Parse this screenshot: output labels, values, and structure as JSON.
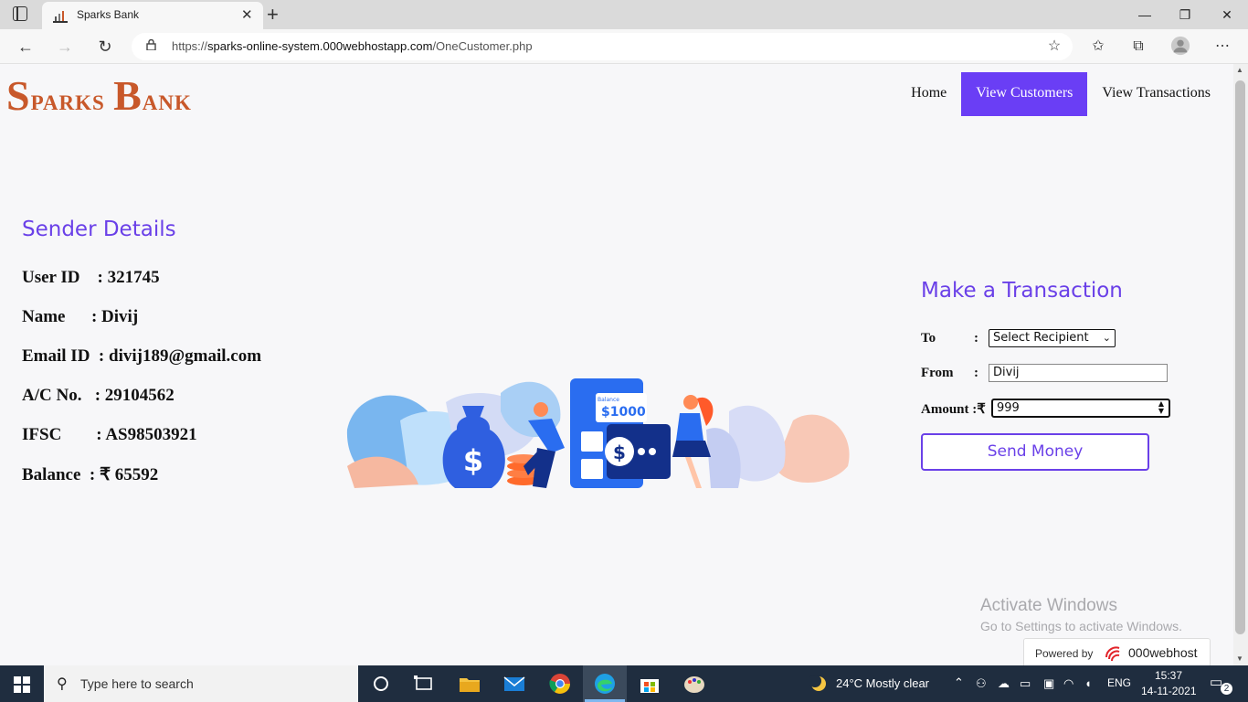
{
  "browser": {
    "tab_title": "Sparks Bank",
    "tab_close": "✕",
    "new_tab": "+",
    "url_prefix": "https://",
    "url_domain": "sparks-online-system.000webhostapp.com",
    "url_path": "/OneCustomer.php",
    "window_buttons": {
      "minimize": "—",
      "restore": "❐",
      "close": "✕"
    }
  },
  "header": {
    "logo": "Sparks Bank",
    "nav": [
      {
        "label": "Home"
      },
      {
        "label": "View Customers",
        "active": true
      },
      {
        "label": "View Transactions"
      }
    ]
  },
  "sender": {
    "heading": "Sender Details",
    "user_id": "User ID    : 321745",
    "name": "Name      : Divij",
    "email": "Email ID  : divij189@gmail.com",
    "account": "A/C No.   : 29104562",
    "ifsc": "IFSC        : AS98503921",
    "balance": "Balance  : ₹ 65592"
  },
  "illustration": {
    "balance_label": "Balance",
    "balance_value": "$1000"
  },
  "transaction": {
    "heading": "Make a Transaction",
    "to_label": "To",
    "from_label": "From",
    "amount_label": "Amount :₹",
    "colon": ":",
    "recipient_selected": "Select Recipient",
    "from_value": "Divij",
    "amount_value": "999",
    "send_button": "Send Money"
  },
  "watermark": {
    "line1": "Activate Windows",
    "line2": "Go to Settings to activate Windows.",
    "powered_by": "Powered by",
    "brand": "000webhost"
  },
  "taskbar": {
    "search_placeholder": "Type here to search",
    "weather": "24°C  Mostly clear",
    "lang": "ENG",
    "time": "15:37",
    "date": "14-11-2021",
    "notifications": "2"
  },
  "colors": {
    "accent": "#6a3ef5",
    "logo": "#c8582a",
    "taskbar": "#1f2d3f"
  }
}
